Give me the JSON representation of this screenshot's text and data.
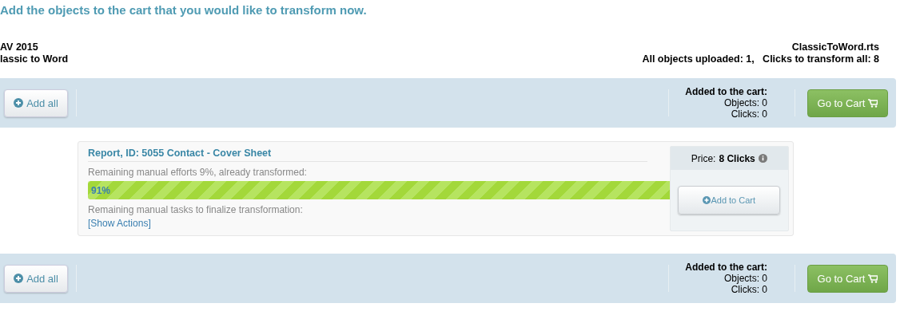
{
  "heading": "Add the objects to the cart that you would like to transform now.",
  "project": {
    "lines": [
      "AV 2015",
      "lassic to Word"
    ]
  },
  "file": {
    "name": "ClassicToWord.rts",
    "summary": "All objects uploaded: 1,   Clicks to transform all: 8"
  },
  "toolbars": [
    {
      "add_all": "Add all",
      "cart_title": "Added to the cart:",
      "objects": "Objects: 0",
      "clicks": "Clicks: 0",
      "go_to_cart": "Go to Cart"
    },
    {
      "add_all": "Add all",
      "cart_title": "Added to the cart:",
      "objects": "Objects: 0",
      "clicks": "Clicks: 0",
      "go_to_cart": "Go to Cart"
    }
  ],
  "items": [
    {
      "title": "Report, ID: 5055 Contact - Cover Sheet",
      "efforts": "Remaining manual efforts 9%, already transformed:",
      "progress": {
        "reading": "91%"
      },
      "tasks": "Remaining manual tasks to finalize transformation:",
      "show_actions": "[Show Actions]",
      "price_label": "Price:",
      "price": "8 Clicks",
      "add_to_cart": "Add to Cart"
    }
  ]
}
